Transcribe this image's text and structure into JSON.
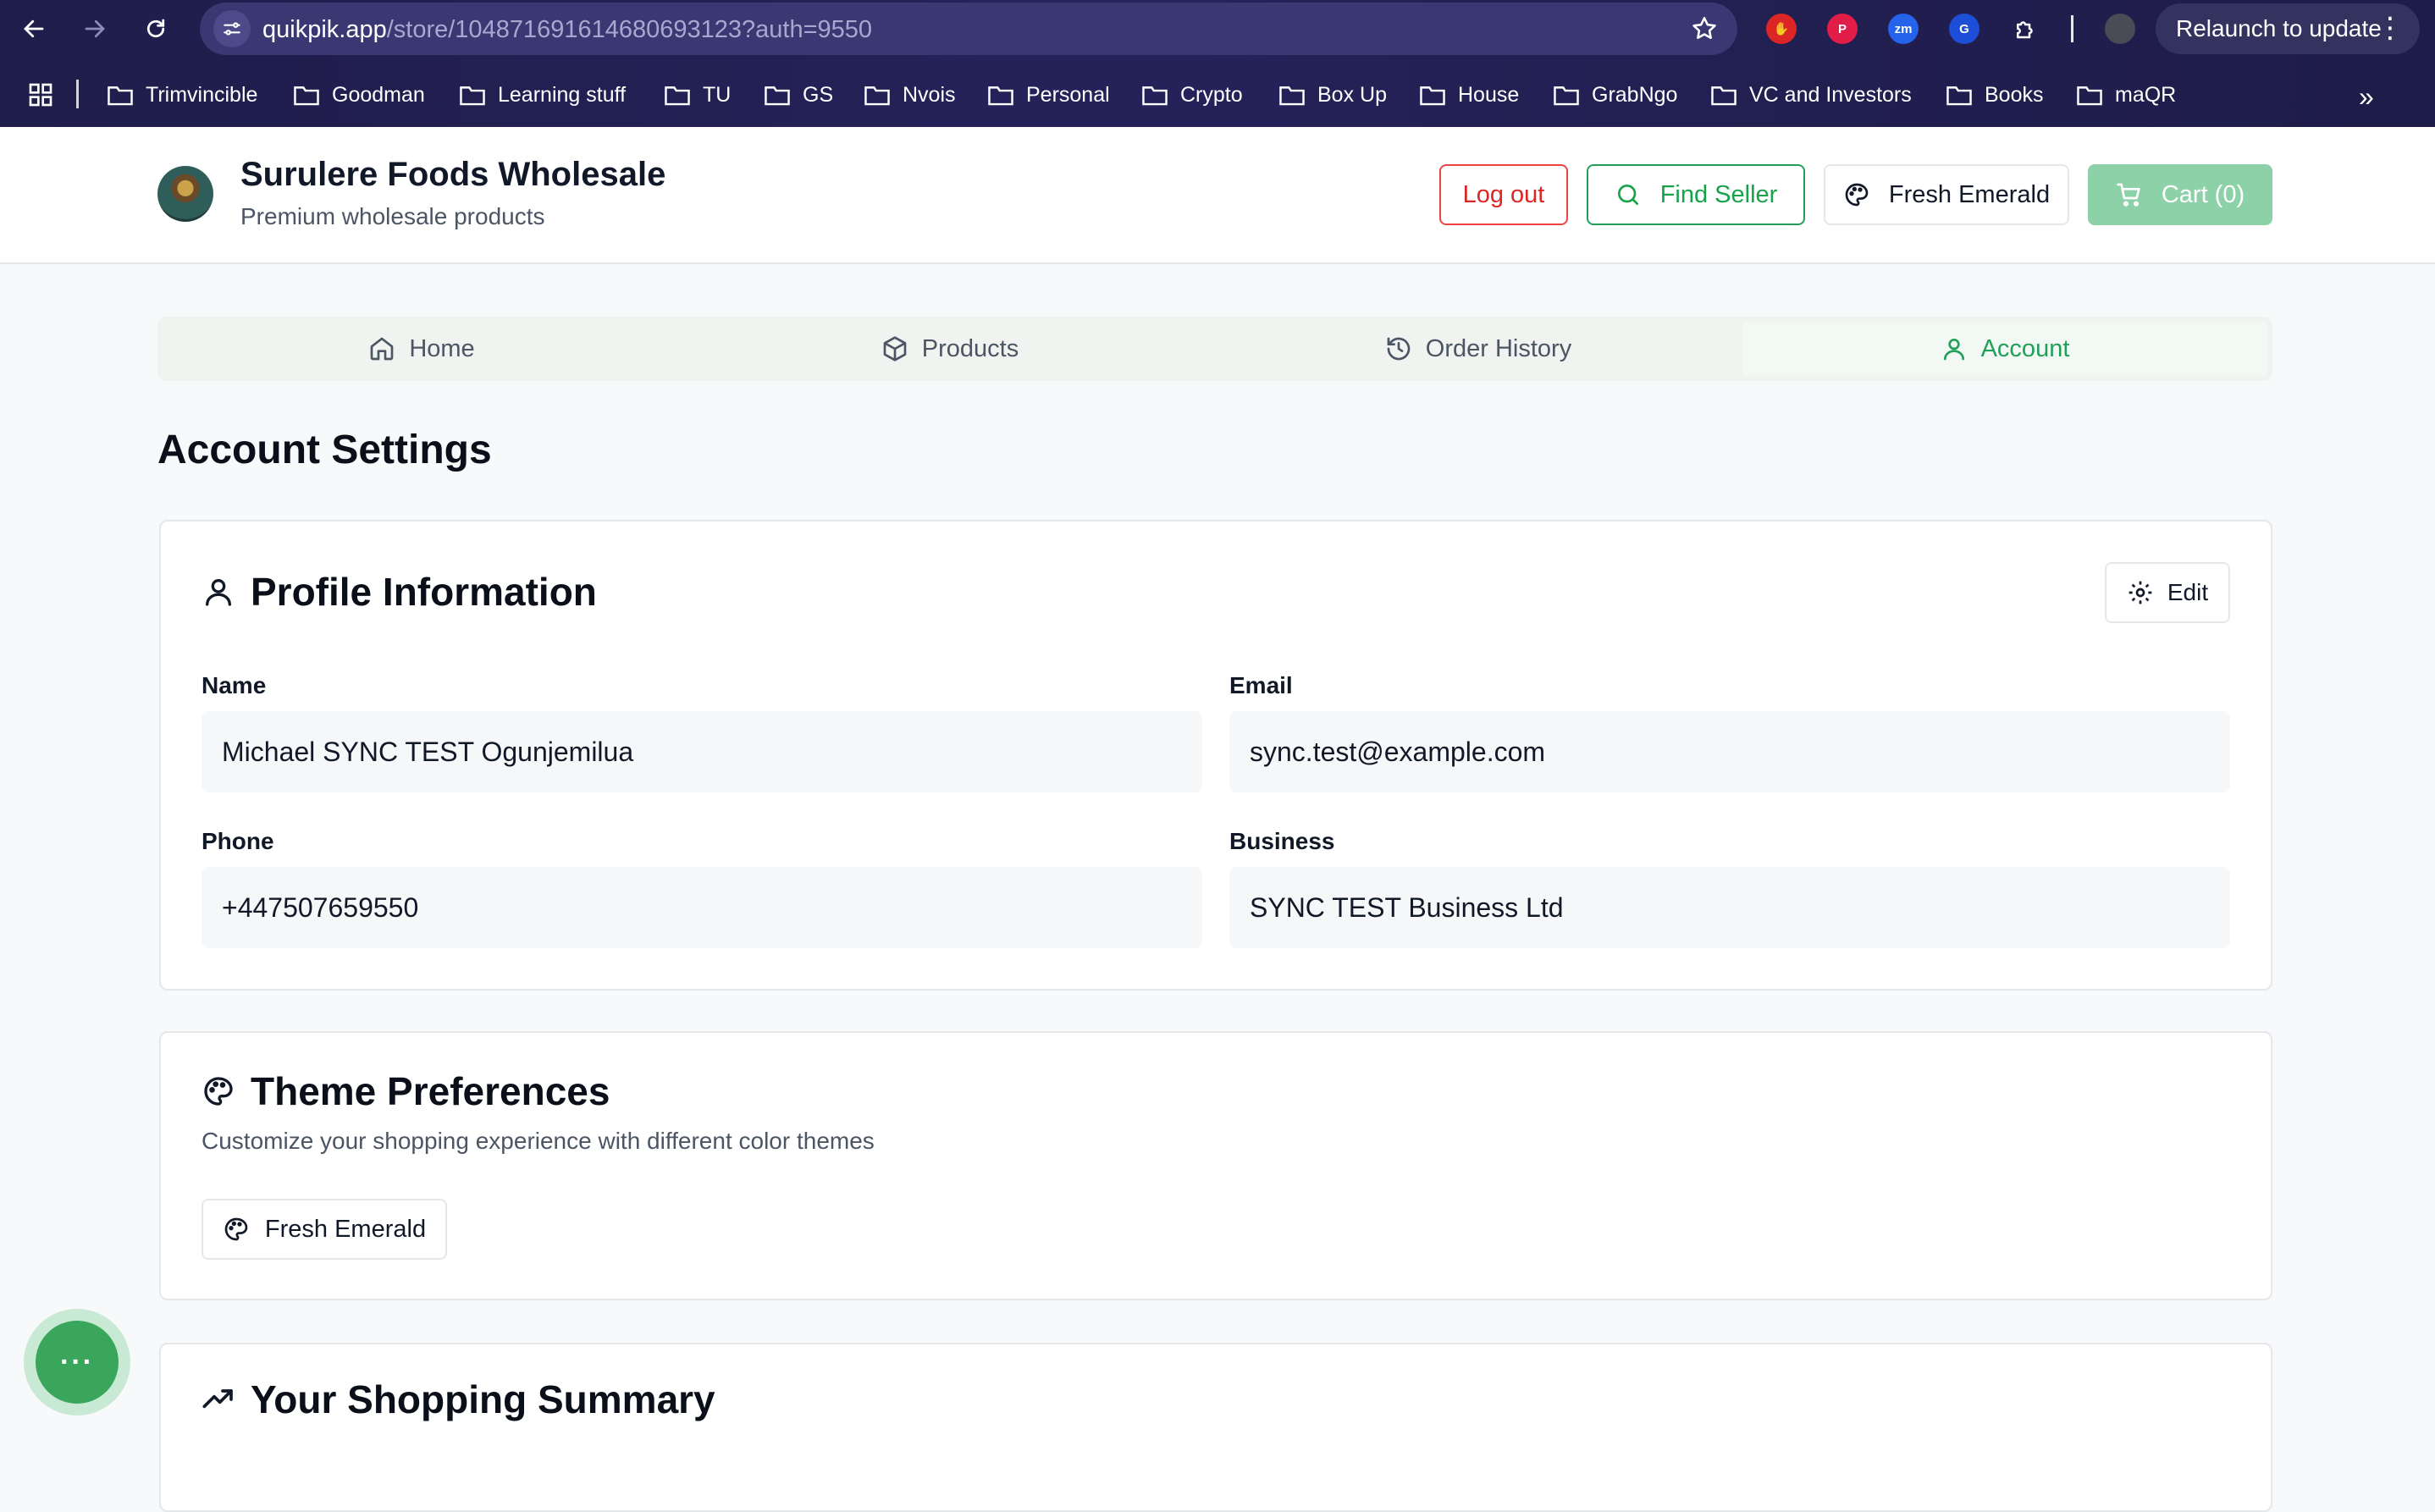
{
  "browser": {
    "url_host": "quikpik.app",
    "url_path": "/store/1048716916146806931​23?auth=9550",
    "relaunch_label": "Relaunch to update",
    "extensions": [
      "zm"
    ],
    "bookmarks": [
      "Trimvincible",
      "Goodman",
      "Learning stuff",
      "TU",
      "GS",
      "Nvois",
      "Personal",
      "Crypto",
      "Box Up",
      "House",
      "GrabNgo",
      "VC and Investors",
      "Books",
      "maQR"
    ]
  },
  "header": {
    "store_name": "Surulere Foods Wholesale",
    "store_subtitle": "Premium wholesale products",
    "logout_label": "Log out",
    "find_seller_label": "Find Seller",
    "theme_label": "Fresh Emerald",
    "cart_label": "Cart (0)"
  },
  "tabs": [
    {
      "label": "Home",
      "active": false
    },
    {
      "label": "Products",
      "active": false
    },
    {
      "label": "Order History",
      "active": false
    },
    {
      "label": "Account",
      "active": true
    }
  ],
  "page": {
    "title": "Account Settings"
  },
  "profile": {
    "title": "Profile Information",
    "edit_label": "Edit",
    "fields": [
      {
        "label": "Name",
        "value": "Michael SYNC TEST Ogunjemilua"
      },
      {
        "label": "Email",
        "value": "sync.test@example.com"
      },
      {
        "label": "Phone",
        "value": "+447507659550"
      },
      {
        "label": "Business",
        "value": "SYNC TEST Business Ltd"
      }
    ]
  },
  "theme": {
    "title": "Theme Preferences",
    "description": "Customize your shopping experience with different color themes",
    "current_theme": "Fresh Emerald"
  },
  "summary": {
    "title": "Your Shopping Summary"
  },
  "fab": {
    "label": "···"
  },
  "colors": {
    "accent": "#22a05a",
    "danger": "#dc2626",
    "cart_disabled": "#8dd1a8"
  }
}
